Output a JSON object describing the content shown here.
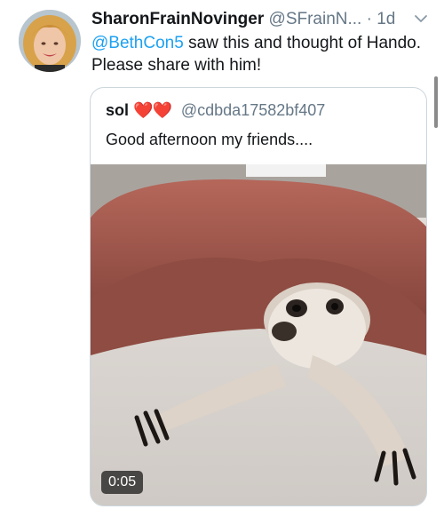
{
  "tweet": {
    "display_name": "SharonFrainNovinger",
    "handle": "@SFrainN...",
    "time": "· 1d",
    "mention": "@BethCon5",
    "text_after_mention": " saw this and thought of Hando. Please share with him!",
    "avatar_icon": "user-avatar-photo",
    "caret_icon": "chevron-down-icon"
  },
  "quote": {
    "name": "sol",
    "emoji": "❤️❤️",
    "handle": "@cdbda17582bf407",
    "text": "Good afternoon my friends....",
    "media_icon": "video-thumbnail-meerkat",
    "duration": "0:05"
  },
  "colors": {
    "link": "#1da1f2",
    "secondary_text": "#657786",
    "border": "#ccd6dd",
    "heart": "#e0245e"
  }
}
